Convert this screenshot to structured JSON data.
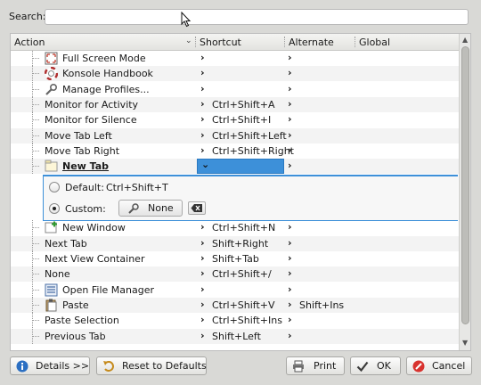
{
  "search": {
    "label": "Search:",
    "value": ""
  },
  "columns": {
    "action": "Action",
    "shortcut": "Shortcut",
    "alternate": "Alternate",
    "global": "Global"
  },
  "rows": [
    {
      "name": "Full Screen Mode",
      "icon": "fullscreen-icon",
      "shortcut": "",
      "alternate": ""
    },
    {
      "name": "Konsole Handbook",
      "icon": "help-lifebuoy-icon",
      "shortcut": "",
      "alternate": ""
    },
    {
      "name": "Manage Profiles...",
      "icon": "wrench-icon",
      "shortcut": "",
      "alternate": ""
    },
    {
      "name": "Monitor for Activity",
      "icon": "",
      "shortcut": "Ctrl+Shift+A",
      "alternate": ""
    },
    {
      "name": "Monitor for Silence",
      "icon": "",
      "shortcut": "Ctrl+Shift+I",
      "alternate": ""
    },
    {
      "name": "Move Tab Left",
      "icon": "",
      "shortcut": "Ctrl+Shift+Left",
      "alternate": ""
    },
    {
      "name": "Move Tab Right",
      "icon": "",
      "shortcut": "Ctrl+Shift+Right",
      "alternate": ""
    },
    {
      "name": "New Tab",
      "icon": "new-tab-icon",
      "shortcut": "",
      "alternate": "",
      "selected": true
    },
    {
      "name": "New Window",
      "icon": "new-window-icon",
      "shortcut": "Ctrl+Shift+N",
      "alternate": ""
    },
    {
      "name": "Next Tab",
      "icon": "",
      "shortcut": "Shift+Right",
      "alternate": ""
    },
    {
      "name": "Next View Container",
      "icon": "",
      "shortcut": "Shift+Tab",
      "alternate": ""
    },
    {
      "name": "None",
      "icon": "",
      "shortcut": "Ctrl+Shift+/",
      "alternate": ""
    },
    {
      "name": "Open File Manager",
      "icon": "file-manager-icon",
      "shortcut": "",
      "alternate": ""
    },
    {
      "name": "Paste",
      "icon": "paste-icon",
      "shortcut": "Ctrl+Shift+V",
      "alternate": "Shift+Ins"
    },
    {
      "name": "Paste Selection",
      "icon": "",
      "shortcut": "Ctrl+Shift+Ins",
      "alternate": ""
    },
    {
      "name": "Previous Tab",
      "icon": "",
      "shortcut": "Shift+Left",
      "alternate": ""
    }
  ],
  "editor": {
    "default_label": "Default:",
    "default_value": "Ctrl+Shift+T",
    "custom_label": "Custom:",
    "none_label": "None",
    "selected_option": "custom"
  },
  "buttons": {
    "details": "Details >>",
    "reset": "Reset to Defaults",
    "print": "Print",
    "ok": "OK",
    "cancel": "Cancel"
  },
  "colors": {
    "selection": "#3d90d9",
    "background": "#d9d9d6"
  }
}
